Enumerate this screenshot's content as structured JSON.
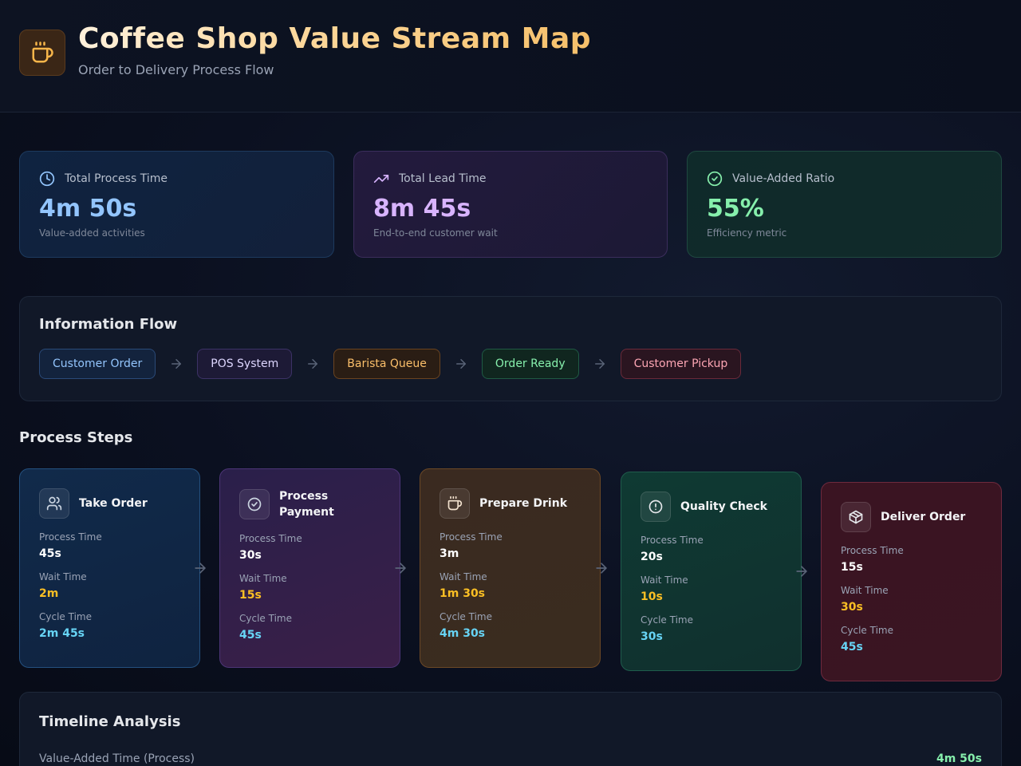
{
  "header": {
    "title": "Coffee Shop Value Stream Map",
    "subtitle": "Order to Delivery Process Flow",
    "logo_icon": "coffee-cup-icon"
  },
  "metrics": [
    {
      "icon": "clock-icon",
      "label": "Total Process Time",
      "value": "4m 50s",
      "description": "Value-added activities",
      "color": "#93c5fd"
    },
    {
      "icon": "trending-up-icon",
      "label": "Total Lead Time",
      "value": "8m 45s",
      "description": "End-to-end customer wait",
      "color": "#d8b4fe"
    },
    {
      "icon": "check-circle-icon",
      "label": "Value-Added Ratio",
      "value": "55%",
      "description": "Efficiency metric",
      "color": "#86efac"
    }
  ],
  "information_flow": {
    "title": "Information Flow",
    "items": [
      "Customer Order",
      "POS System",
      "Barista Queue",
      "Order Ready",
      "Customer Pickup"
    ]
  },
  "process_steps": {
    "title": "Process Steps",
    "labels": {
      "process": "Process Time",
      "wait": "Wait Time",
      "cycle": "Cycle Time"
    },
    "steps": [
      {
        "name": "Take Order",
        "icon": "users-icon",
        "process": "45s",
        "wait": "2m",
        "cycle": "2m 45s"
      },
      {
        "name": "Process Payment",
        "icon": "check-circle-icon",
        "process": "30s",
        "wait": "15s",
        "cycle": "45s"
      },
      {
        "name": "Prepare Drink",
        "icon": "coffee-cup-icon",
        "process": "3m",
        "wait": "1m 30s",
        "cycle": "4m 30s"
      },
      {
        "name": "Quality Check",
        "icon": "alert-circle-icon",
        "process": "20s",
        "wait": "10s",
        "cycle": "30s"
      },
      {
        "name": "Deliver Order",
        "icon": "package-icon",
        "process": "15s",
        "wait": "30s",
        "cycle": "45s"
      }
    ]
  },
  "timeline": {
    "title": "Timeline Analysis",
    "rows": [
      {
        "label": "Value-Added Time (Process)",
        "value": "4m 50s"
      }
    ]
  }
}
